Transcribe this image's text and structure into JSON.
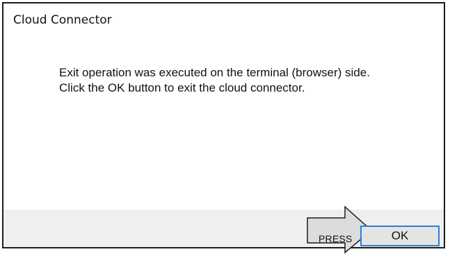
{
  "dialog": {
    "title": "Cloud Connector",
    "message_line1": "Exit operation was executed on the terminal (browser) side.",
    "message_line2": "Click the OK button to exit the cloud connector."
  },
  "buttons": {
    "ok_label": "OK"
  },
  "callout": {
    "label": "PRESS",
    "icon": "arrow-right-callout"
  },
  "colors": {
    "focus_border": "#2d7fd6",
    "footer_bg": "#efefef",
    "callout_fill": "#dcdcdc"
  }
}
